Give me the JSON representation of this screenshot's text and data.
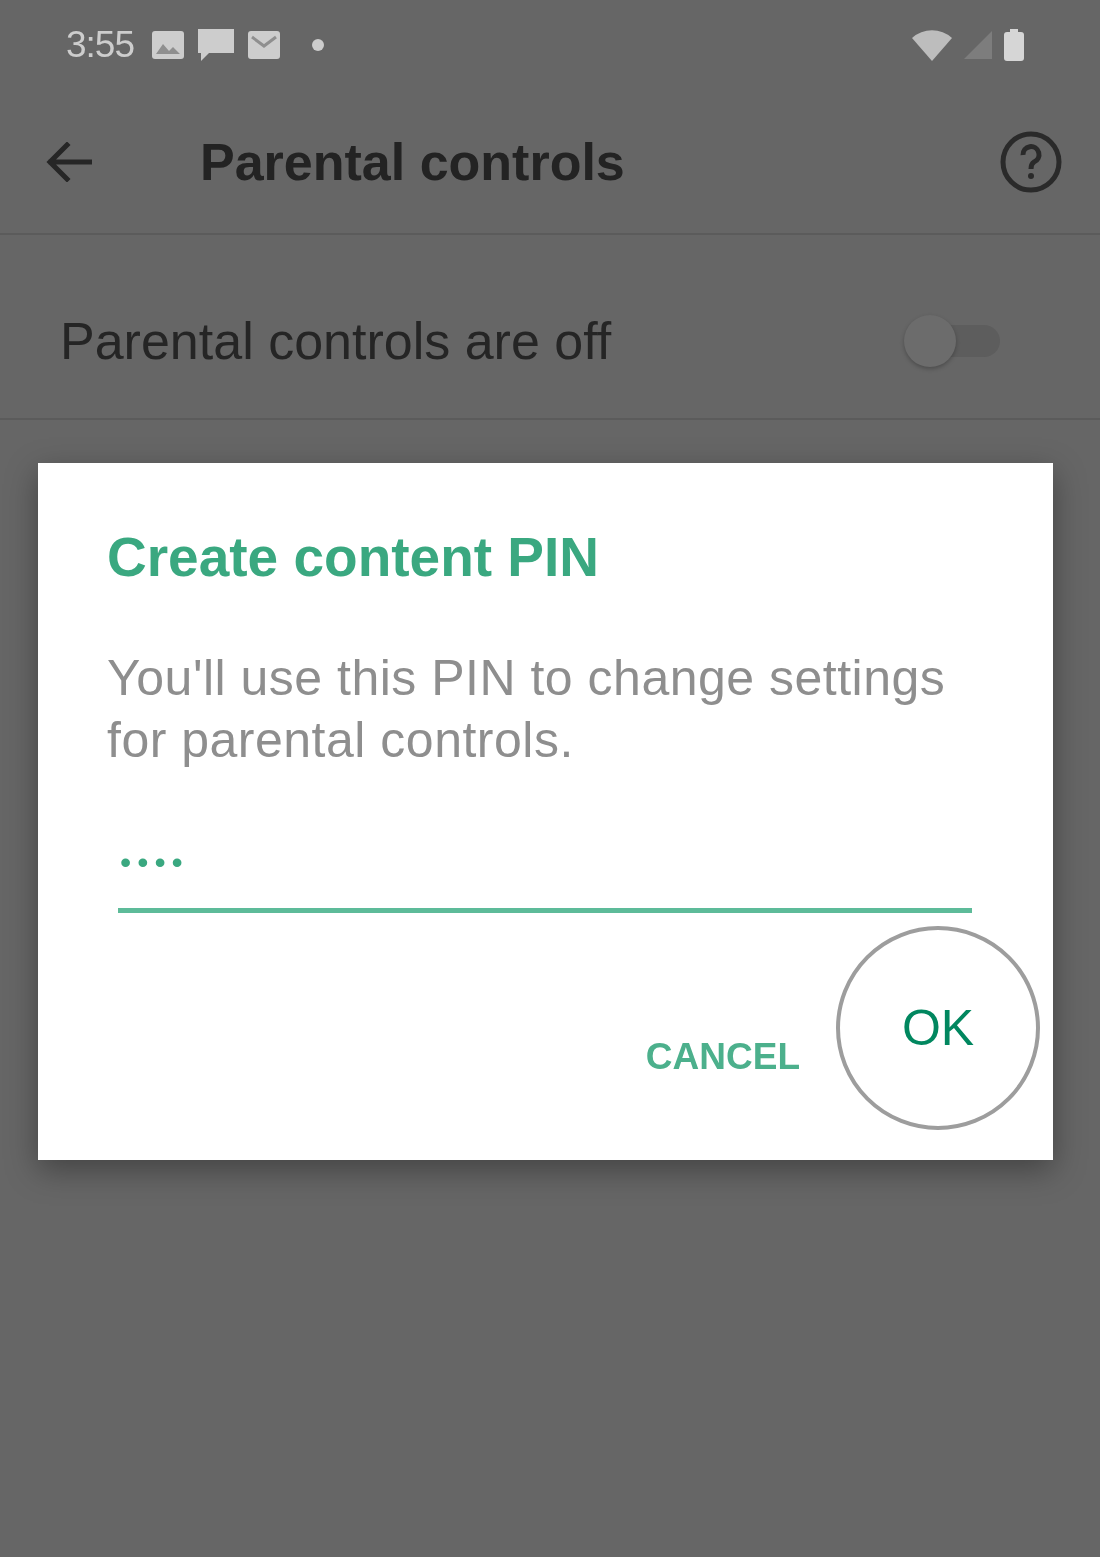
{
  "status_bar": {
    "time": "3:55"
  },
  "app_bar": {
    "title": "Parental controls"
  },
  "settings": [
    {
      "label": "Parental controls are off",
      "on": false
    }
  ],
  "dialog": {
    "title": "Create content PIN",
    "message": "You'll use this PIN to change settings for parental controls.",
    "pin_field": {
      "value": "••••",
      "focused": true
    },
    "buttons": [
      {
        "label": "CANCEL",
        "highlighted": false
      },
      {
        "label": "OK",
        "highlighted": true
      }
    ]
  }
}
